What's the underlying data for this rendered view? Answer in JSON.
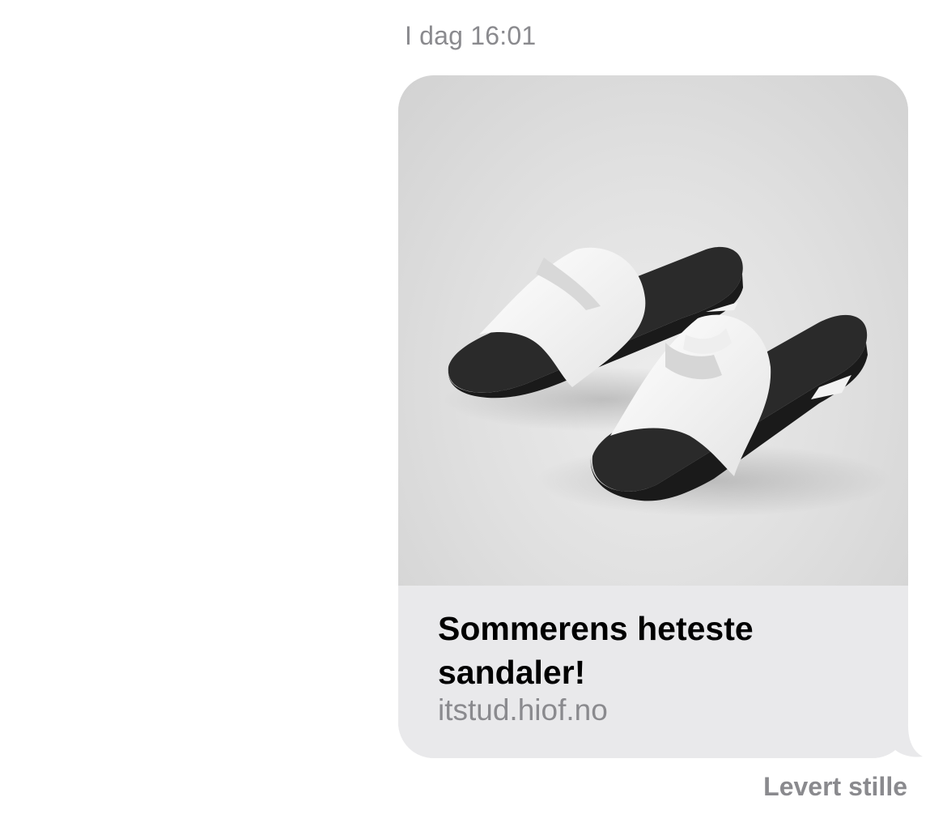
{
  "conversation": {
    "timestamp": "I dag 16:01",
    "message": {
      "link_preview": {
        "image_description_icon": "sandals-image",
        "title": "Sommerens heteste sandaler!",
        "domain": "itstud.hiof.no"
      },
      "status": "Levert stille"
    }
  },
  "colors": {
    "bubble_background": "#e9e9eb",
    "secondary_text": "#8a8a8e",
    "title_text": "#000000"
  }
}
